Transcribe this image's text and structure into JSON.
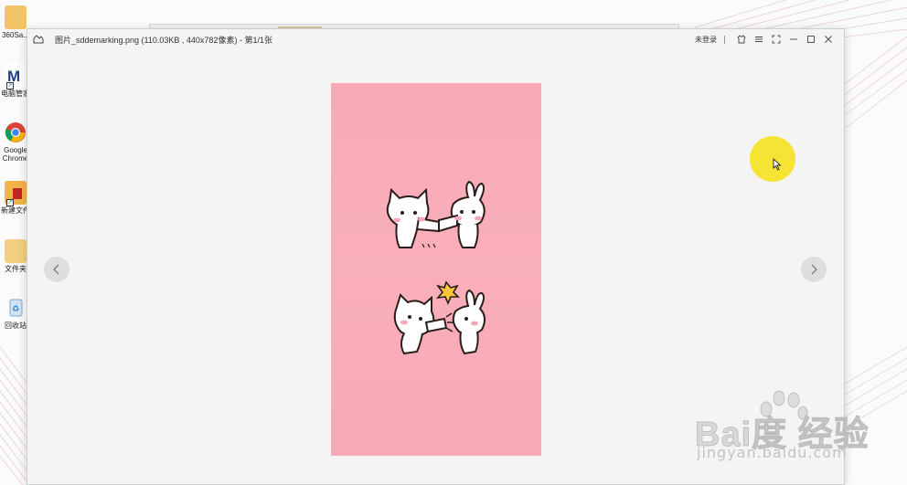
{
  "desktop": {
    "icons": [
      {
        "label": "360Sa...",
        "icon": "folder-icon"
      },
      {
        "label": "电脑管家",
        "icon": "app-shortcut-icon"
      },
      {
        "label": "Google Chrome",
        "icon": "chrome-icon"
      },
      {
        "label": "新建文件",
        "icon": "video-folder-icon"
      },
      {
        "label": "文件夹",
        "icon": "folder-icon"
      },
      {
        "label": "回收站",
        "icon": "recycle-bin-icon"
      }
    ]
  },
  "viewer": {
    "title": "图片_sddemarking.png (110.03KB , 440x782像素) - 第1/1张",
    "login_label": "未登录",
    "buttons": [
      "skin-icon",
      "menu-icon",
      "fullscreen-icon",
      "minimize-icon",
      "maximize-icon",
      "close-icon"
    ],
    "image_description_icon": "sticker-image"
  },
  "watermark": {
    "text": "Bai度 经验",
    "url": "jingyan.baidu.com"
  },
  "colors": {
    "image_bg": "#f9afba",
    "cursor_highlight": "#f6e32a",
    "window_bg": "#f4f4f4"
  }
}
